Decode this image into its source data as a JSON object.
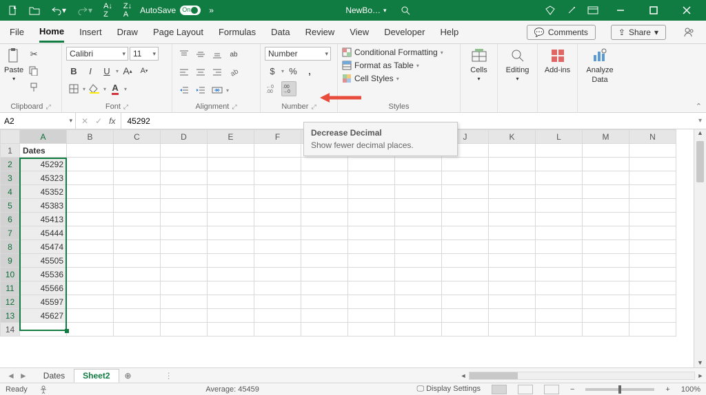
{
  "titlebar": {
    "autosave_label": "AutoSave",
    "autosave_on": "On",
    "filename": "NewBo…",
    "overflow": "»"
  },
  "tabs": {
    "file": "File",
    "home": "Home",
    "insert": "Insert",
    "draw": "Draw",
    "page_layout": "Page Layout",
    "formulas": "Formulas",
    "data": "Data",
    "review": "Review",
    "view": "View",
    "developer": "Developer",
    "help": "Help",
    "comments": "Comments",
    "share": "Share"
  },
  "ribbon": {
    "clipboard": {
      "paste": "Paste",
      "label": "Clipboard"
    },
    "font": {
      "name": "Calibri",
      "size": "11",
      "label": "Font",
      "bold": "B",
      "italic": "I",
      "underline": "U"
    },
    "alignment": {
      "label": "Alignment",
      "wrap": "ab"
    },
    "number": {
      "format": "Number",
      "label": "Number",
      "currency": "$",
      "percent": "%",
      "comma": ","
    },
    "styles": {
      "cond_fmt": "Conditional Formatting",
      "as_table": "Format as Table",
      "cell_styles": "Cell Styles",
      "label": "Styles"
    },
    "cells": {
      "label": "Cells"
    },
    "editing": {
      "label": "Editing"
    },
    "addins": {
      "label": "Add-ins"
    },
    "analyze": {
      "label": "Analyze",
      "sub": "Data"
    }
  },
  "tooltip": {
    "title": "Decrease Decimal",
    "body": "Show fewer decimal places."
  },
  "namebox": "A2",
  "formula": "45292",
  "columns": [
    "A",
    "B",
    "C",
    "D",
    "E",
    "F",
    "G",
    "H",
    "I",
    "J",
    "K",
    "L",
    "M",
    "N"
  ],
  "rows": [
    {
      "n": 1,
      "a": "Dates",
      "bold": true,
      "sel": false
    },
    {
      "n": 2,
      "a": "45292",
      "sel": true
    },
    {
      "n": 3,
      "a": "45323",
      "sel": true
    },
    {
      "n": 4,
      "a": "45352",
      "sel": true
    },
    {
      "n": 5,
      "a": "45383",
      "sel": true
    },
    {
      "n": 6,
      "a": "45413",
      "sel": true
    },
    {
      "n": 7,
      "a": "45444",
      "sel": true
    },
    {
      "n": 8,
      "a": "45474",
      "sel": true
    },
    {
      "n": 9,
      "a": "45505",
      "sel": true
    },
    {
      "n": 10,
      "a": "45536",
      "sel": true
    },
    {
      "n": 11,
      "a": "45566",
      "sel": true
    },
    {
      "n": 12,
      "a": "45597",
      "sel": true
    },
    {
      "n": 13,
      "a": "45627",
      "sel": true
    },
    {
      "n": 14,
      "a": "",
      "sel": false
    }
  ],
  "sheets": {
    "tab1": "Dates",
    "tab2": "Sheet2"
  },
  "status": {
    "ready": "Ready",
    "average_label": "Average:",
    "average_val": "45459",
    "display": "Display Settings",
    "zoom": "100%"
  }
}
